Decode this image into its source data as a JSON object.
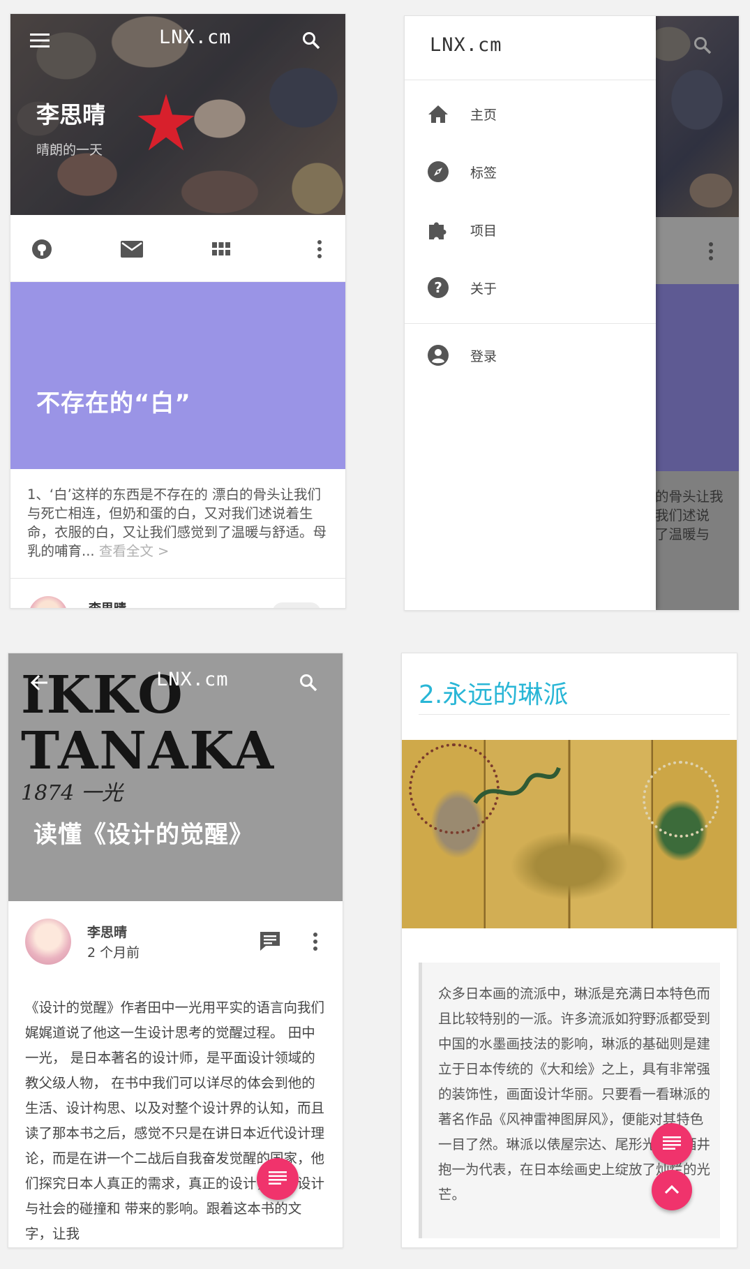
{
  "brand": "LNX.cm",
  "colors": {
    "accent": "#f0336c",
    "heading_link": "#29b6d6",
    "purple_card": "#9a94e6",
    "icon_grey": "#555555"
  },
  "screen1": {
    "profile_name": "李思晴",
    "profile_subtitle": "晴朗的一天",
    "icons": [
      "github-icon",
      "mail-icon",
      "apps-grid-icon",
      "more-vert-icon"
    ],
    "post_title": "不存在的“白”",
    "excerpt": "1、‘白’这样的东西是不存在的 漂白的骨头让我们与死亡相连，但奶和蛋的白，又对我们述说着生命，衣服的白，又让我们感觉到了温暖与舒适。母乳的哺育...",
    "read_more": "查看全文 >",
    "author": "李思晴"
  },
  "screen2": {
    "drawer_title": "LNX.cm",
    "nav_items": [
      {
        "icon": "home-icon",
        "label": "主页"
      },
      {
        "icon": "compass-icon",
        "label": "标签"
      },
      {
        "icon": "puzzle-icon",
        "label": "项目"
      },
      {
        "icon": "help-icon",
        "label": "关于"
      }
    ],
    "login": {
      "icon": "account-circle-icon",
      "label": "登录"
    },
    "bg_fragment": [
      "的骨头让我",
      "我们述说",
      "了温暖与"
    ]
  },
  "screen3": {
    "poster_line1": "IKKO",
    "poster_line2": "TANAKA",
    "poster_script": "1874 一光",
    "post_title": "读懂《设计的觉醒》",
    "author": "李思晴",
    "time": "2 个月前",
    "body": "《设计的觉醒》作者田中一光用平实的语言向我们娓娓道说了他这一生设计思考的觉醒过程。 田中一光， 是日本著名的设计师，是平面设计领域的教父级人物， 在书中我们可以详尽的体会到他的生活、设计构思、以及对整个设计界的认知，而且读了那本书之后，感觉不只是在讲日本近代设计理论，而是在讲一个二战后自我奋发觉醒的国家，他们探究日本人真正的需求，真正的设计，反思设计与社会的碰撞和 带来的影响。跟着这本书的文字，让我"
  },
  "screen4": {
    "heading": "2.永远的琳派",
    "quote": "众多日本画的流派中，琳派是充满日本特色而且比较特别的一派。许多流派如狩野派都受到中国的水墨画技法的影响，琳派的基础则是建立于日本传统的《大和绘》之上，具有非常强的装饰性，画面设计华丽。只要看一看琳派的著名作品《风神雷神图屏风》，便能对其特色一目了然。琳派以俵屋宗达、尾形光琳和酒井抱一为代表，在日本绘画史上绽放了灿烂的光芒。"
  }
}
